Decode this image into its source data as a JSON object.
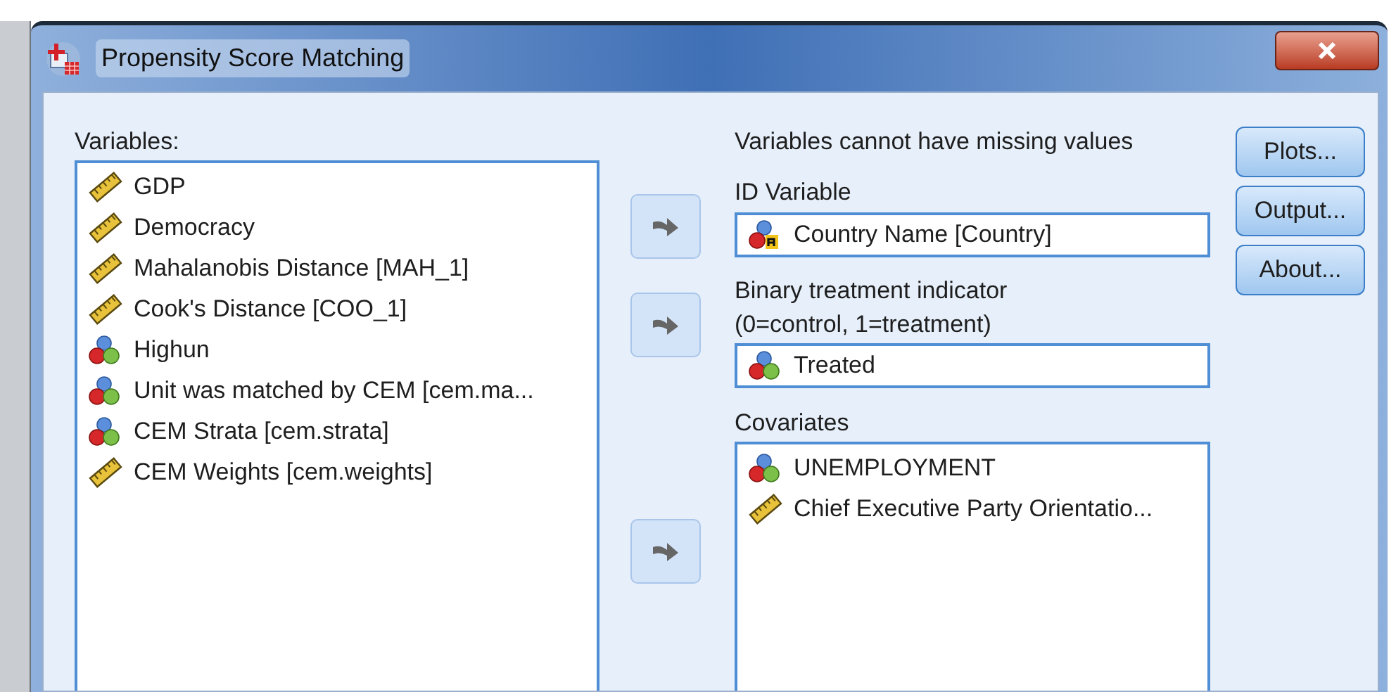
{
  "window": {
    "title": "Propensity Score Matching"
  },
  "variables": {
    "label": "Variables:",
    "items": [
      {
        "kind": "scale",
        "name": "GDP"
      },
      {
        "kind": "scale",
        "name": "Democracy"
      },
      {
        "kind": "scale",
        "name": "Mahalanobis Distance [MAH_1]"
      },
      {
        "kind": "scale",
        "name": "Cook's Distance [COO_1]"
      },
      {
        "kind": "nominal",
        "name": "Highun"
      },
      {
        "kind": "nominal",
        "name": "Unit was matched by CEM [cem.ma..."
      },
      {
        "kind": "nominal",
        "name": "CEM Strata [cem.strata]"
      },
      {
        "kind": "scale",
        "name": "CEM Weights [cem.weights]"
      }
    ]
  },
  "note": "Variables cannot have missing values",
  "id_variable": {
    "label": "ID Variable",
    "value": {
      "kind": "string",
      "name": "Country Name [Country]"
    }
  },
  "treatment": {
    "label": "Binary treatment indicator",
    "sublabel": "(0=control, 1=treatment)",
    "value": {
      "kind": "nominal",
      "name": "Treated"
    }
  },
  "covariates": {
    "label": "Covariates",
    "items": [
      {
        "kind": "nominal",
        "name": "UNEMPLOYMENT"
      },
      {
        "kind": "scale",
        "name": "Chief Executive Party Orientatio..."
      }
    ]
  },
  "buttons": [
    "Plots...",
    "Output...",
    "About..."
  ]
}
